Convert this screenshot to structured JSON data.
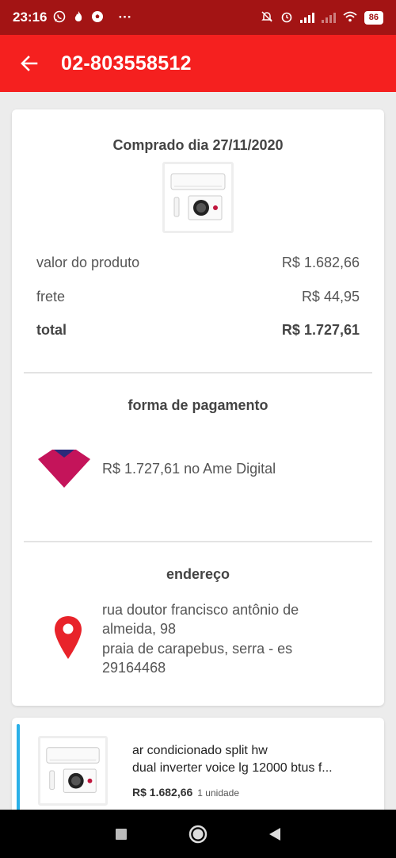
{
  "status_bar": {
    "time": "23:16",
    "left_icons": [
      "whatsapp-icon",
      "flame-icon",
      "soccer-ball-icon"
    ],
    "more": "···",
    "battery": "86"
  },
  "app_bar": {
    "title": "02-803558512",
    "back_icon": "arrow-left-icon"
  },
  "order": {
    "purchase_date": "Comprado dia 27/11/2020",
    "rows": [
      {
        "label": "valor do produto",
        "value": "R$ 1.682,66"
      },
      {
        "label": "frete",
        "value": "R$ 44,95"
      },
      {
        "label": "total",
        "value": "R$ 1.727,61"
      }
    ],
    "payment": {
      "title": "forma de pagamento",
      "text": "R$ 1.727,61 no Ame Digital",
      "logo_color": "#c4145a"
    },
    "address": {
      "title": "endereço",
      "lines": [
        "rua doutor francisco antônio de",
        "almeida, 98",
        "praia de carapebus, serra - es",
        "29164468"
      ],
      "pin_color": "#e8232a"
    }
  },
  "item": {
    "name_lines": [
      "ar condicionado split hw",
      "dual inverter voice lg 12000 btus f..."
    ],
    "price": "R$ 1.682,66",
    "quantity": "1 unidade",
    "accent_color": "#2ab0e8"
  },
  "colors": {
    "status_bar": "#a31414",
    "app_bar": "#f5201f",
    "background": "#ececec"
  }
}
